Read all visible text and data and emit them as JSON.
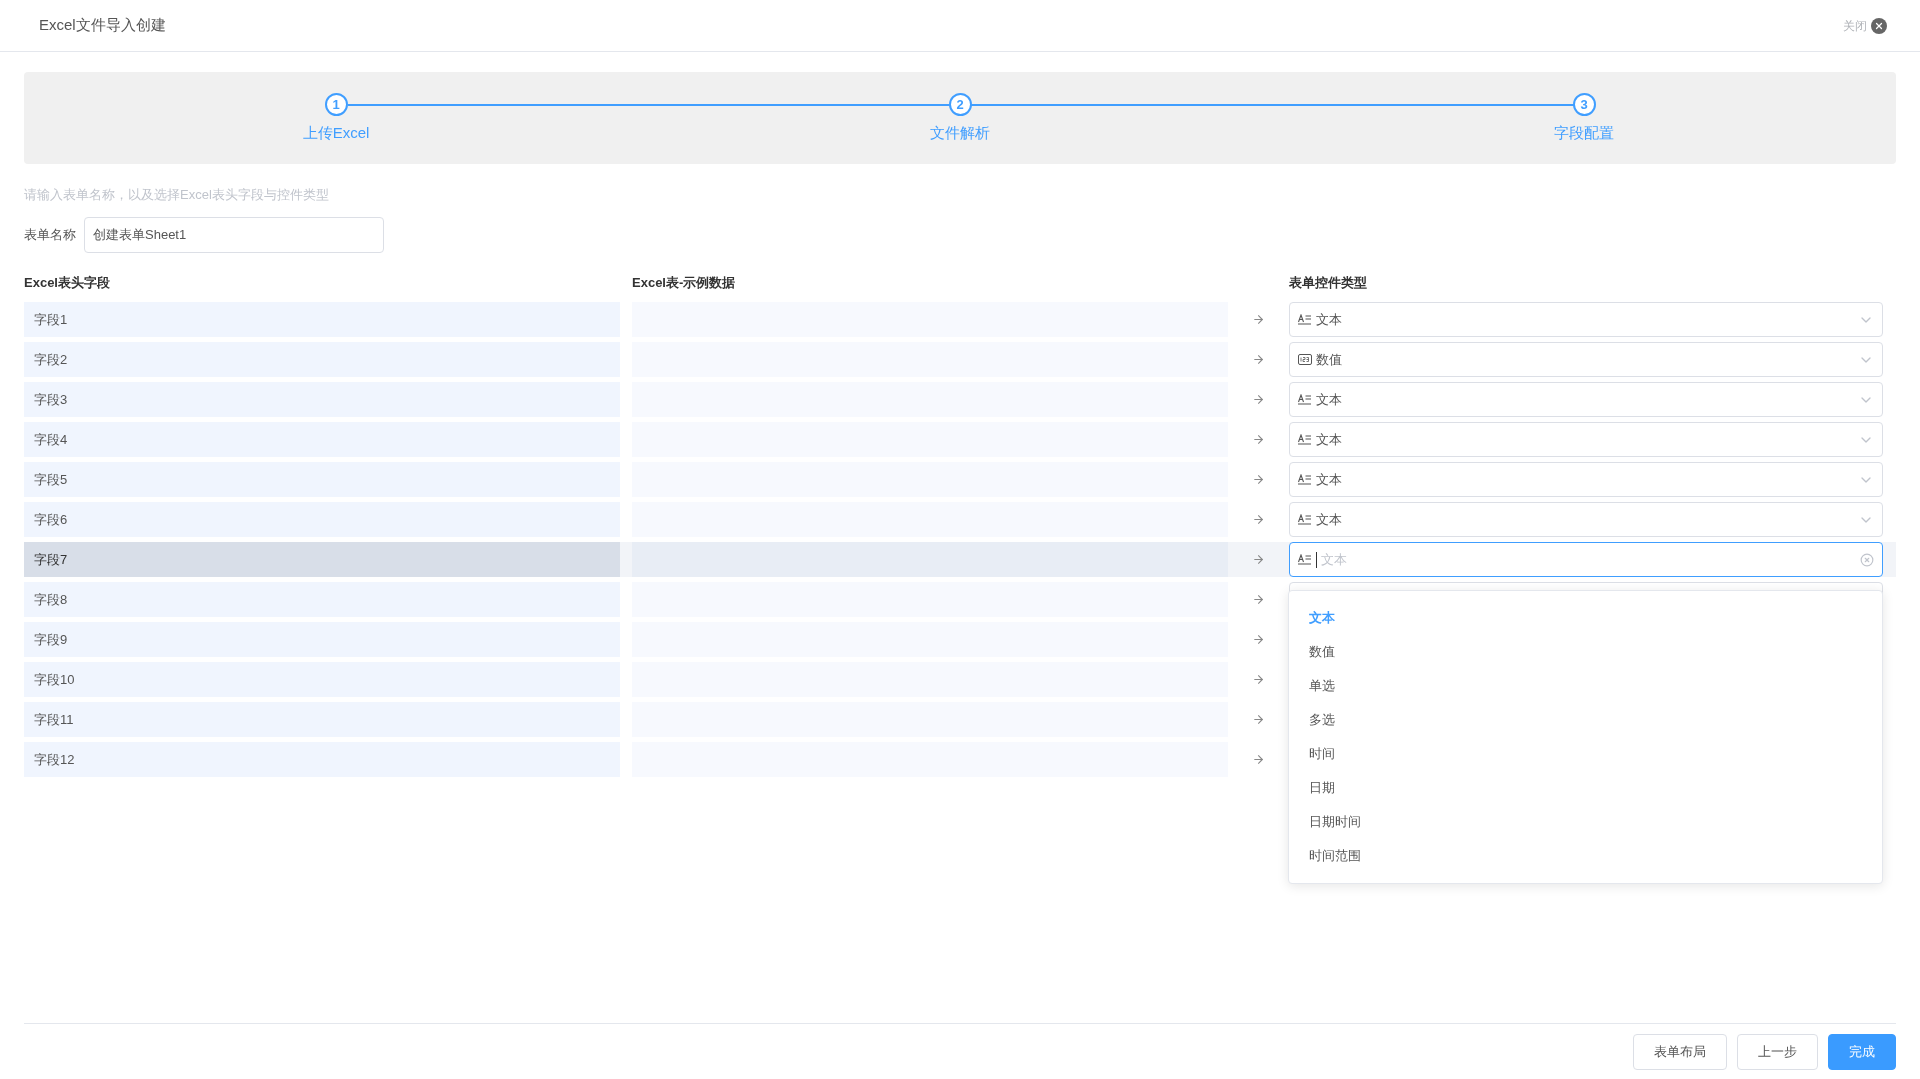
{
  "window": {
    "title": "Excel文件导入创建",
    "close_label": "关闭"
  },
  "steps": [
    {
      "number": "1",
      "label": "上传Excel",
      "done": true
    },
    {
      "number": "2",
      "label": "文件解析",
      "done": true
    },
    {
      "number": "3",
      "label": "字段配置",
      "done": true
    }
  ],
  "hint": "请输入表单名称，以及选择Excel表头字段与控件类型",
  "form_name": {
    "label": "表单名称",
    "value": "创建表单Sheet1"
  },
  "columns": [
    "Excel表头字段",
    "Excel表-示例数据",
    "表单控件类型"
  ],
  "rows": [
    {
      "field": "字段1",
      "highlighted": false,
      "control": {
        "kind": "text",
        "value": "文本",
        "open": false
      }
    },
    {
      "field": "字段2",
      "highlighted": false,
      "control": {
        "kind": "number",
        "value": "数值",
        "open": false
      }
    },
    {
      "field": "字段3",
      "highlighted": false,
      "control": {
        "kind": "text",
        "value": "文本",
        "open": false
      }
    },
    {
      "field": "字段4",
      "highlighted": false,
      "control": {
        "kind": "text",
        "value": "文本",
        "open": false
      }
    },
    {
      "field": "字段5",
      "highlighted": false,
      "control": {
        "kind": "text",
        "value": "文本",
        "open": false
      }
    },
    {
      "field": "字段6",
      "highlighted": false,
      "control": {
        "kind": "text",
        "value": "文本",
        "open": false
      }
    },
    {
      "field": "字段7",
      "highlighted": true,
      "control": {
        "kind": "text",
        "placeholder": "文本",
        "open": true
      }
    },
    {
      "field": "字段8",
      "highlighted": false
    },
    {
      "field": "字段9",
      "highlighted": false
    },
    {
      "field": "字段10",
      "highlighted": false
    },
    {
      "field": "字段11",
      "highlighted": false
    },
    {
      "field": "字段12",
      "highlighted": false
    }
  ],
  "dropdown": [
    {
      "label": "文本",
      "selected": true
    },
    {
      "label": "数值",
      "selected": false
    },
    {
      "label": "单选",
      "selected": false
    },
    {
      "label": "多选",
      "selected": false
    },
    {
      "label": "时间",
      "selected": false
    },
    {
      "label": "日期",
      "selected": false
    },
    {
      "label": "日期时间",
      "selected": false
    },
    {
      "label": "时间范围",
      "selected": false
    }
  ],
  "buttons": [
    {
      "label": "表单布局",
      "primary": false
    },
    {
      "label": "上一步",
      "primary": false
    },
    {
      "label": "完成",
      "primary": true
    }
  ]
}
